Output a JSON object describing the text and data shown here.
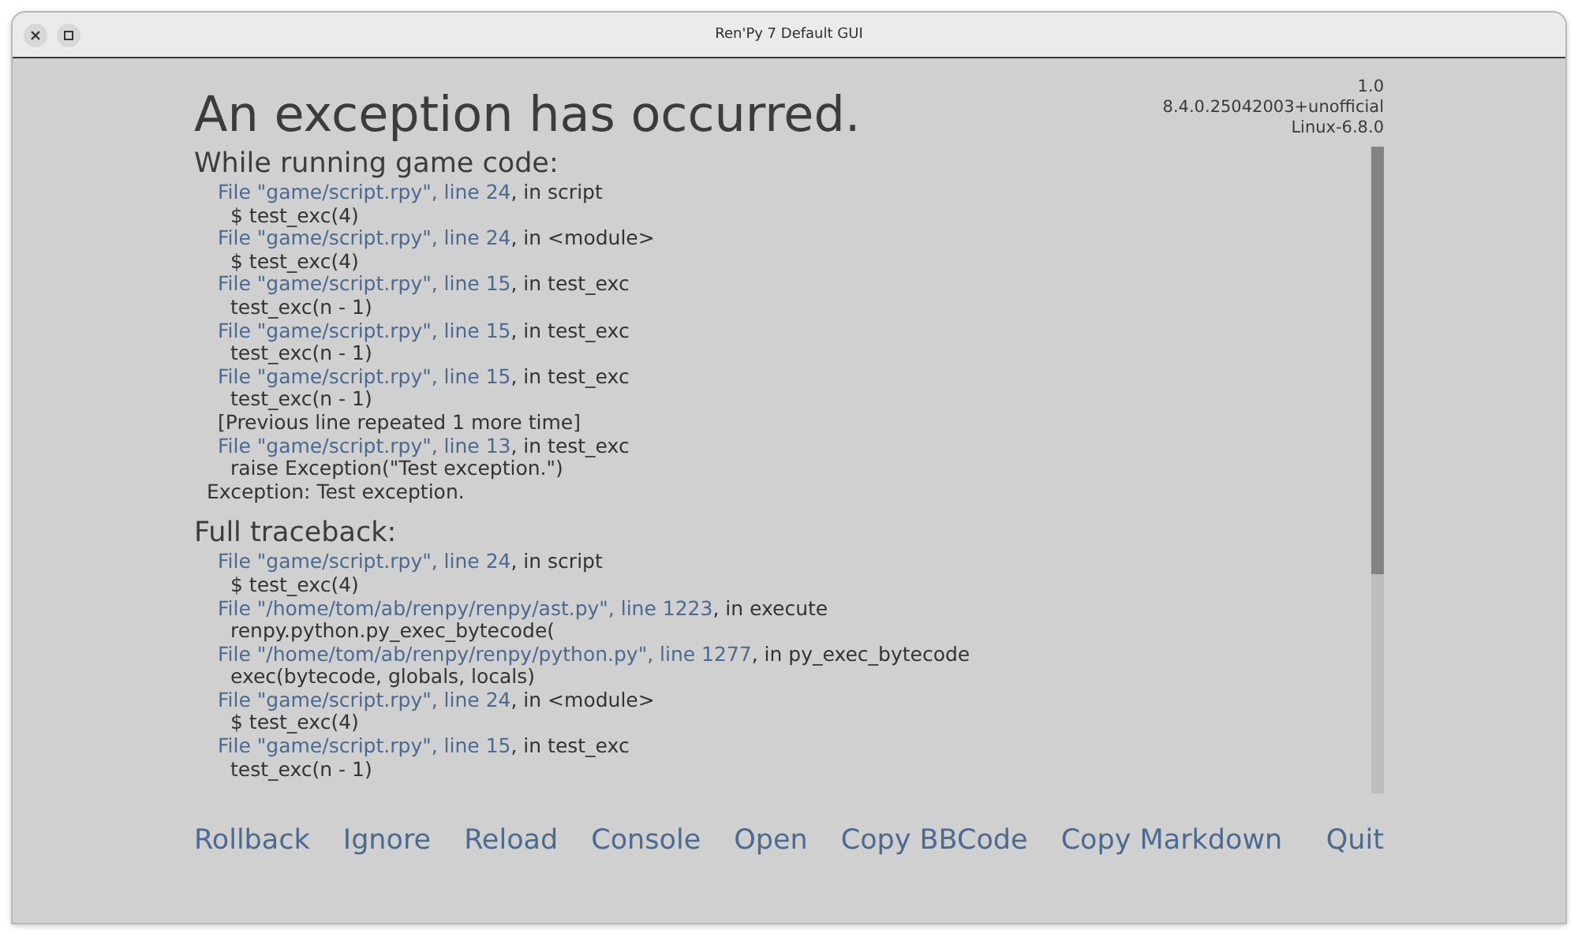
{
  "window": {
    "title": "Ren'Py 7 Default GUI"
  },
  "heading": "An exception has occurred.",
  "version_info": [
    "1.0",
    "8.4.0.25042003+unofficial",
    "Linux-6.8.0"
  ],
  "sections": [
    {
      "title": "While running game code:",
      "lines": [
        {
          "kind": "file",
          "link": "File \"game/script.rpy\", line 24",
          "rest": ", in script"
        },
        {
          "kind": "code",
          "text": "$ test_exc(4)"
        },
        {
          "kind": "file",
          "link": "File \"game/script.rpy\", line 24",
          "rest": ", in <module>"
        },
        {
          "kind": "code",
          "text": "$ test_exc(4)"
        },
        {
          "kind": "file",
          "link": "File \"game/script.rpy\", line 15",
          "rest": ", in test_exc"
        },
        {
          "kind": "code",
          "text": "test_exc(n - 1)"
        },
        {
          "kind": "file",
          "link": "File \"game/script.rpy\", line 15",
          "rest": ", in test_exc"
        },
        {
          "kind": "code",
          "text": "test_exc(n - 1)"
        },
        {
          "kind": "file",
          "link": "File \"game/script.rpy\", line 15",
          "rest": ", in test_exc"
        },
        {
          "kind": "code",
          "text": "test_exc(n - 1)"
        },
        {
          "kind": "note",
          "text": "[Previous line repeated 1 more time]"
        },
        {
          "kind": "file",
          "link": "File \"game/script.rpy\", line 13",
          "rest": ", in test_exc"
        },
        {
          "kind": "code",
          "text": "raise Exception(\"Test exception.\")"
        },
        {
          "kind": "exception",
          "text": "Exception: Test exception."
        }
      ]
    },
    {
      "title": "Full traceback:",
      "lines": [
        {
          "kind": "file",
          "link": "File \"game/script.rpy\", line 24",
          "rest": ", in script"
        },
        {
          "kind": "code",
          "text": "$ test_exc(4)"
        },
        {
          "kind": "file",
          "link": "File \"/home/tom/ab/renpy/renpy/ast.py\", line 1223",
          "rest": ", in execute"
        },
        {
          "kind": "code",
          "text": "renpy.python.py_exec_bytecode("
        },
        {
          "kind": "file",
          "link": "File \"/home/tom/ab/renpy/renpy/python.py\", line 1277",
          "rest": ", in py_exec_bytecode"
        },
        {
          "kind": "code",
          "text": "exec(bytecode, globals, locals)"
        },
        {
          "kind": "file",
          "link": "File \"game/script.rpy\", line 24",
          "rest": ", in <module>"
        },
        {
          "kind": "code",
          "text": "$ test_exc(4)"
        },
        {
          "kind": "file",
          "link": "File \"game/script.rpy\", line 15",
          "rest": ", in test_exc"
        },
        {
          "kind": "code",
          "text": "test_exc(n - 1)"
        }
      ]
    }
  ],
  "actions": [
    "Rollback",
    "Ignore",
    "Reload",
    "Console",
    "Open",
    "Copy BBCode",
    "Copy Markdown"
  ],
  "quit": "Quit"
}
